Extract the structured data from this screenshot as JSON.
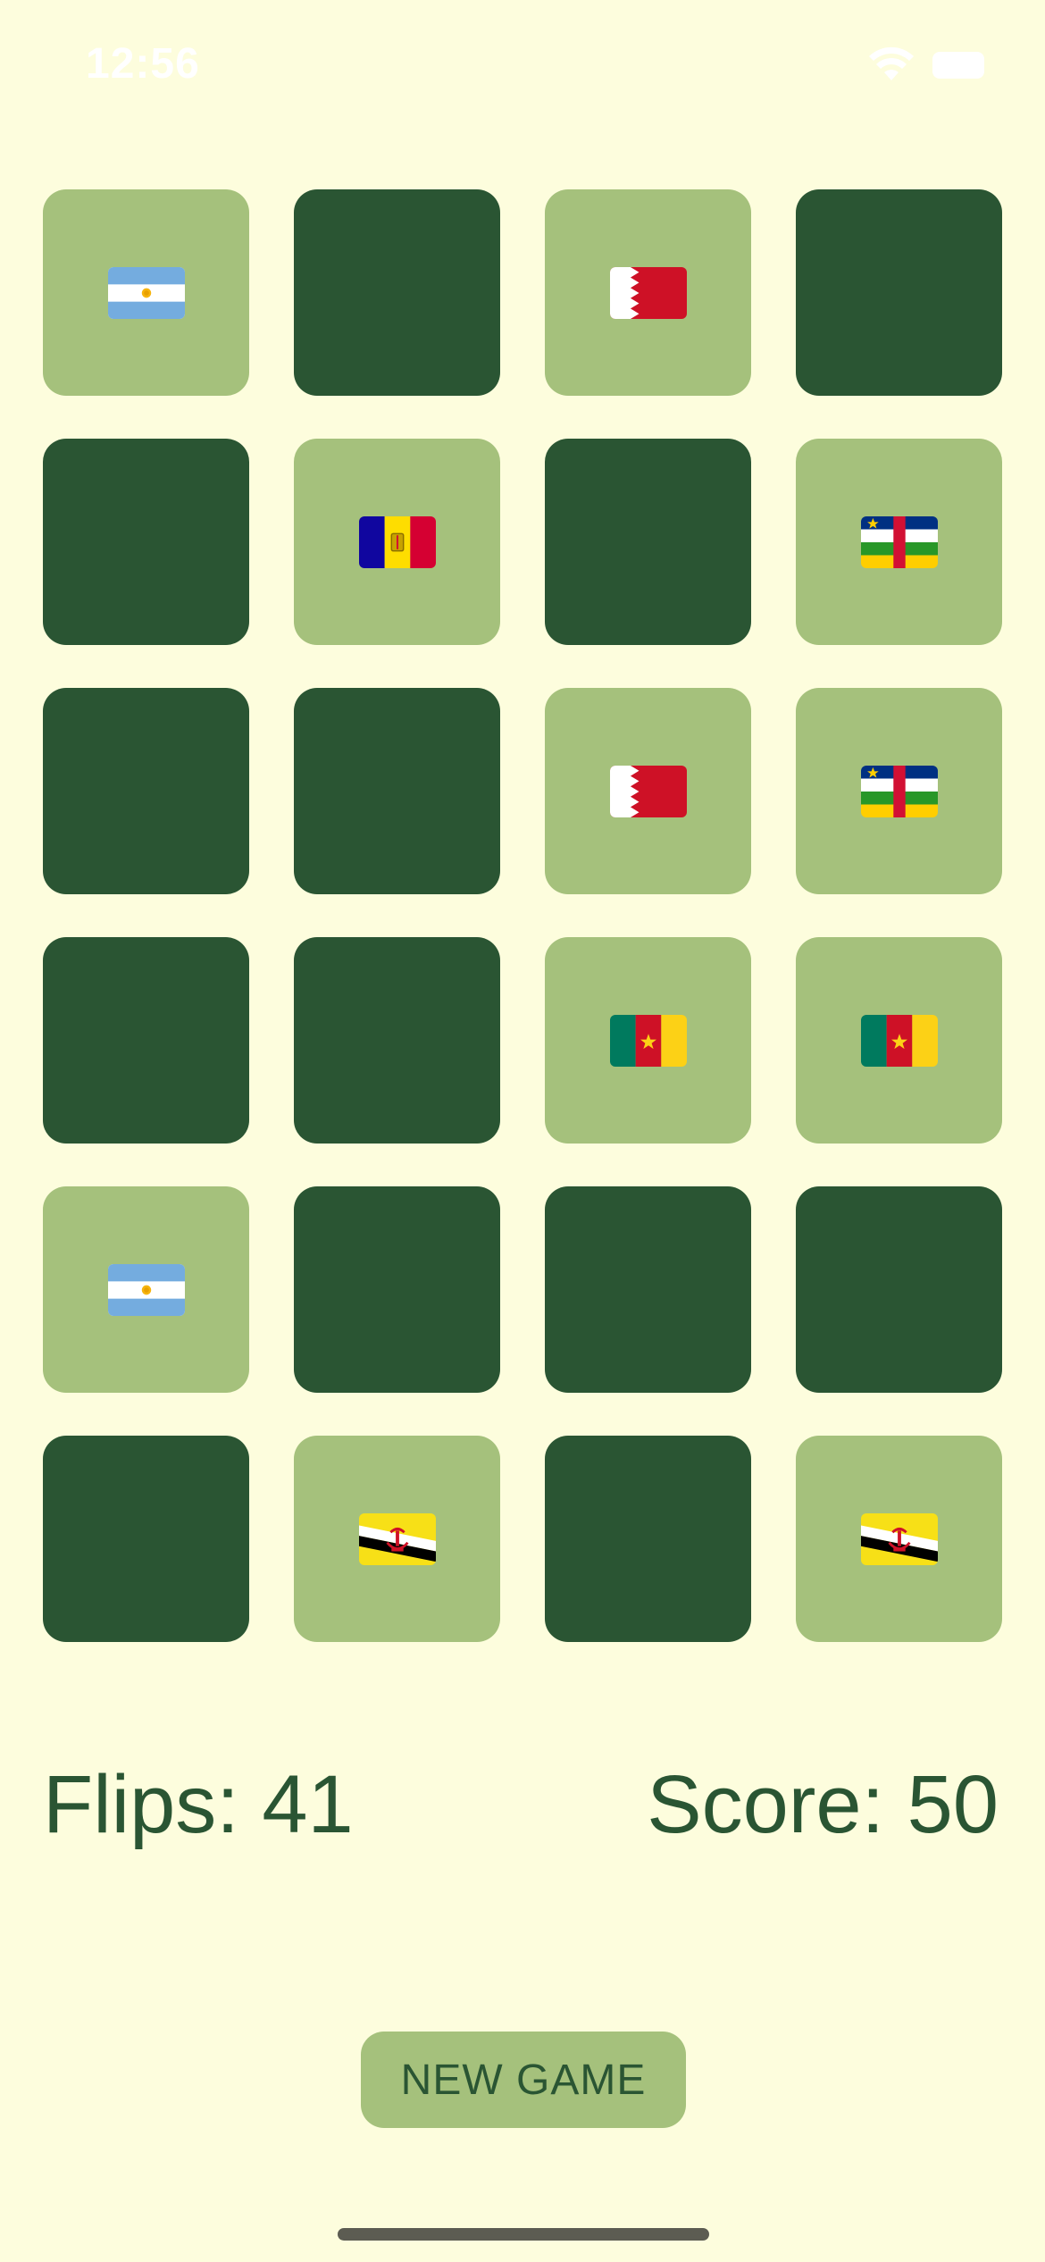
{
  "status_bar": {
    "time": "12:56",
    "icons": [
      "wifi-icon",
      "battery-icon"
    ]
  },
  "colors": {
    "background": "#fdfddd",
    "card_face_down": "#2a5533",
    "card_face_up": "#a5c17c",
    "text": "#2a5533"
  },
  "board": {
    "columns": 4,
    "cards": [
      {
        "state": "up",
        "flag": "argentina"
      },
      {
        "state": "down",
        "flag": ""
      },
      {
        "state": "up",
        "flag": "bahrain"
      },
      {
        "state": "down",
        "flag": ""
      },
      {
        "state": "down",
        "flag": ""
      },
      {
        "state": "up",
        "flag": "andorra"
      },
      {
        "state": "down",
        "flag": ""
      },
      {
        "state": "up",
        "flag": "central-african-republic"
      },
      {
        "state": "down",
        "flag": ""
      },
      {
        "state": "down",
        "flag": ""
      },
      {
        "state": "up",
        "flag": "bahrain"
      },
      {
        "state": "up",
        "flag": "central-african-republic"
      },
      {
        "state": "down",
        "flag": ""
      },
      {
        "state": "down",
        "flag": ""
      },
      {
        "state": "up",
        "flag": "cameroon"
      },
      {
        "state": "up",
        "flag": "cameroon"
      },
      {
        "state": "up",
        "flag": "argentina"
      },
      {
        "state": "down",
        "flag": ""
      },
      {
        "state": "down",
        "flag": ""
      },
      {
        "state": "down",
        "flag": ""
      },
      {
        "state": "down",
        "flag": ""
      },
      {
        "state": "up",
        "flag": "brunei"
      },
      {
        "state": "down",
        "flag": ""
      },
      {
        "state": "up",
        "flag": "brunei"
      }
    ]
  },
  "stats": {
    "flips_text": "Flips: 41",
    "score_text": "Score: 50"
  },
  "new_game_label": "NEW GAME"
}
